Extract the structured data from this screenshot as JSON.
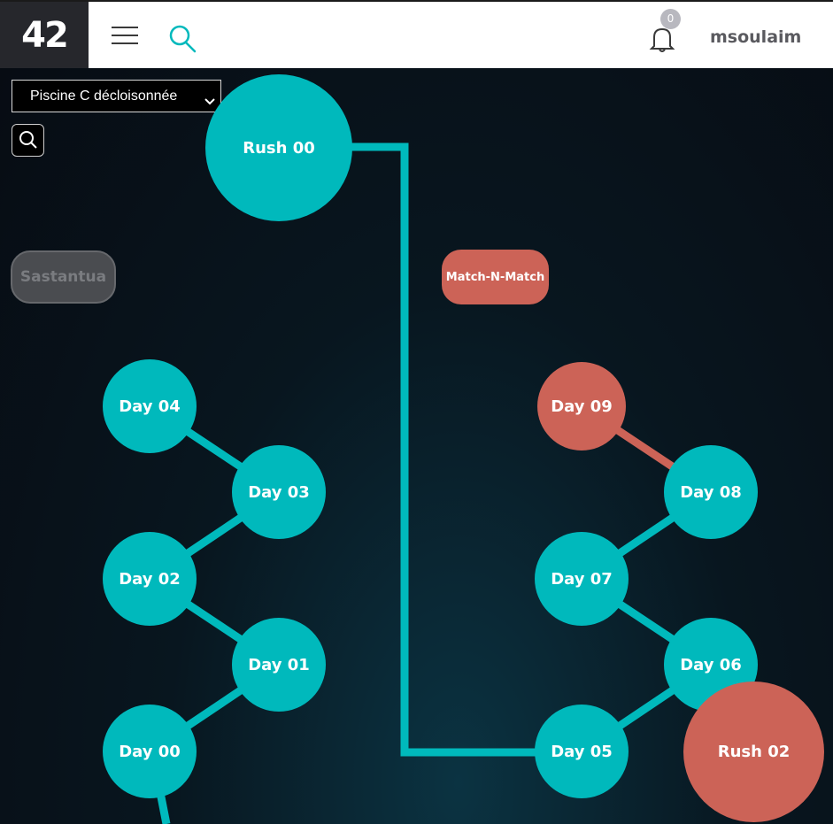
{
  "header": {
    "logo_text": "42",
    "menu_icon": "hamburger-menu-icon",
    "search_icon": "search-icon",
    "notification_icon": "bell-icon",
    "notification_count": "0",
    "username": "msoulaim"
  },
  "controls": {
    "cursus_selected": "Piscine C décloisonnée",
    "graph_search_icon": "search-icon"
  },
  "projects": {
    "rush00": "Rush 00",
    "sastantua": "Sastantua",
    "match_n_match": "Match-N-Match",
    "day04": "Day 04",
    "day03": "Day 03",
    "day02": "Day 02",
    "day01": "Day 01",
    "day00": "Day 00",
    "day09": "Day 09",
    "day08": "Day 08",
    "day07": "Day 07",
    "day06": "Day 06",
    "day05": "Day 05",
    "rush02": "Rush 02"
  },
  "colors": {
    "available": "#00b9bc",
    "failed": "#cc6357",
    "unavailable": "#4a4c50",
    "background": "#070b12"
  }
}
